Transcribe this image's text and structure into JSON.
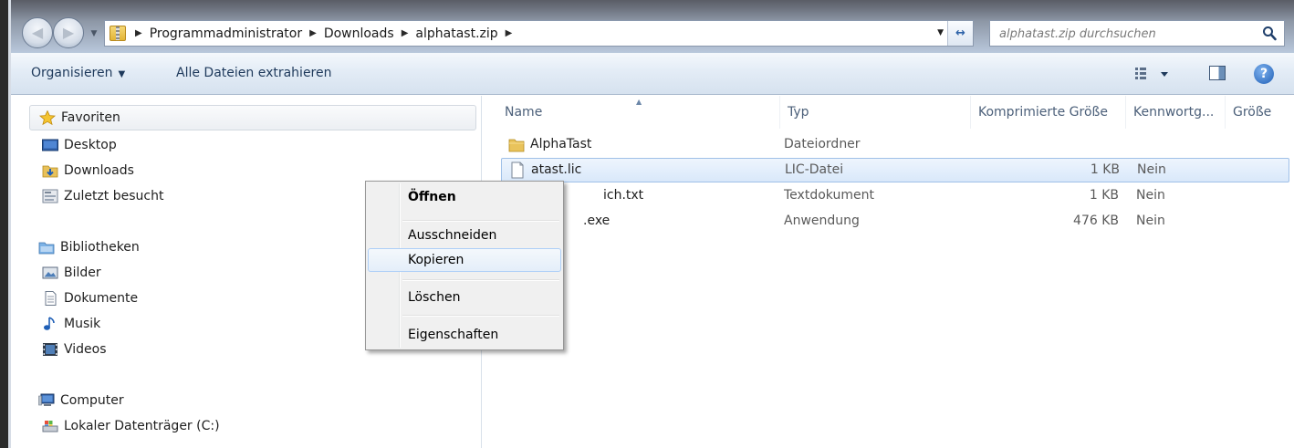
{
  "address": {
    "crumbs": [
      "Programmadministrator",
      "Downloads",
      "alphatast.zip"
    ]
  },
  "search": {
    "placeholder": "alphatast.zip durchsuchen"
  },
  "toolbar": {
    "organize_label": "Organisieren",
    "extract_label": "Alle Dateien extrahieren"
  },
  "nav": {
    "favorites": {
      "label": "Favoriten",
      "items": [
        "Desktop",
        "Downloads",
        "Zuletzt besucht"
      ]
    },
    "libraries": {
      "label": "Bibliotheken",
      "items": [
        "Bilder",
        "Dokumente",
        "Musik",
        "Videos"
      ]
    },
    "computer": {
      "label": "Computer",
      "items": [
        "Lokaler Datenträger (C:)"
      ]
    }
  },
  "columns": [
    "Name",
    "Typ",
    "Komprimierte Größe",
    "Kennwortg...",
    "Größe"
  ],
  "files": [
    {
      "name": "AlphaTast",
      "type": "Dateiordner",
      "compressed": "",
      "password": "",
      "icon": "folder-icon"
    },
    {
      "name": "atast.lic",
      "type": "LIC-Datei",
      "compressed": "1 KB",
      "password": "Nein",
      "icon": "file-icon",
      "selected": true
    },
    {
      "name": "ich.txt",
      "type": "Textdokument",
      "compressed": "1 KB",
      "password": "Nein",
      "icon": "text-file-icon"
    },
    {
      "name": ".exe",
      "type": "Anwendung",
      "compressed": "476 KB",
      "password": "Nein",
      "icon": "exe-icon"
    }
  ],
  "context_menu": {
    "items": [
      "Öffnen",
      "Ausschneiden",
      "Kopieren",
      "Löschen",
      "Eigenschaften"
    ],
    "default_item": "Öffnen",
    "highlighted_item": "Kopieren"
  },
  "colors": {
    "selection": "#d9e8fa",
    "menu_bg": "#f0f0f0",
    "link_text": "#1e395b"
  }
}
